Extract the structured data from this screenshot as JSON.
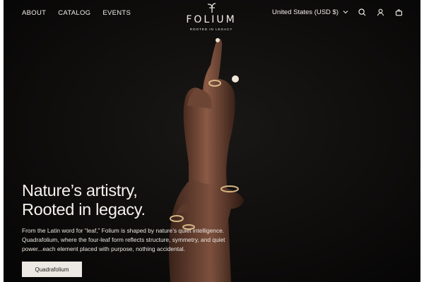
{
  "header": {
    "nav": [
      "ABOUT",
      "CATALOG",
      "EVENTS"
    ],
    "logo": {
      "name": "FOLIUM",
      "tagline": "ROOTED IN LEGACY"
    },
    "currency": "United States (USD $)",
    "icons": [
      "chevron-down-icon",
      "search-icon",
      "account-icon",
      "cart-icon"
    ]
  },
  "hero": {
    "headline": [
      "Nature’s artistry,",
      "Rooted in legacy."
    ],
    "body": "From the Latin word for “leaf,” Folium is shaped by nature’s quiet intelligence. Quadrafolium, where the four-leaf form reflects structure, symmetry, and quiet power...each element placed with purpose, nothing accidental.",
    "cta_label": "Quadrafolium"
  },
  "colors": {
    "background": "#0b0a09",
    "text": "#f2eee9",
    "button_bg": "#ece8e3",
    "button_text": "#1c1b1a"
  }
}
